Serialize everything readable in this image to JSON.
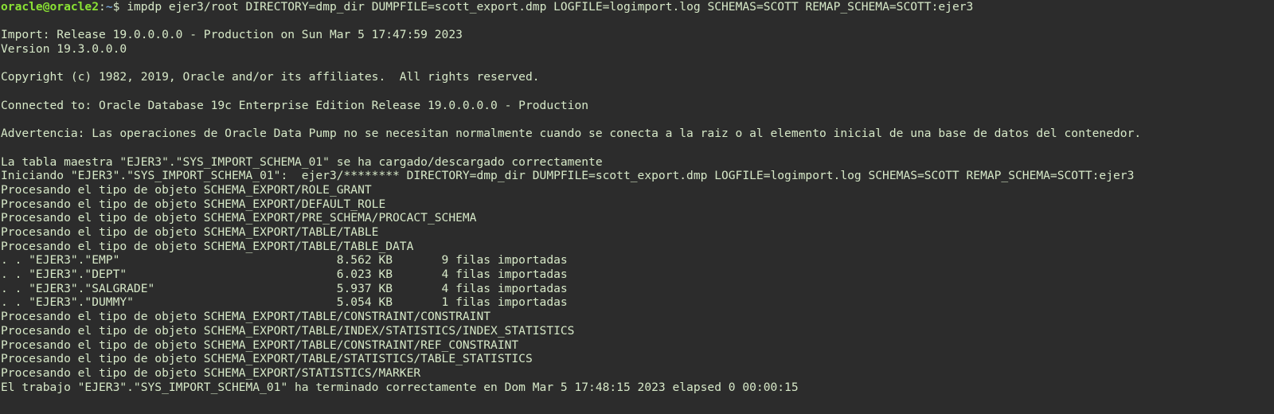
{
  "prompt": {
    "user_host": "oracle@oracle2",
    "separator": ":",
    "path": "~",
    "symbol": "$ ",
    "command": "impdp ejer3/root DIRECTORY=dmp_dir DUMPFILE=scott_export.dmp LOGFILE=logimport.log SCHEMAS=SCOTT REMAP_SCHEMA=SCOTT:ejer3"
  },
  "output": [
    "",
    "Import: Release 19.0.0.0.0 - Production on Sun Mar 5 17:47:59 2023",
    "Version 19.3.0.0.0",
    "",
    "Copyright (c) 1982, 2019, Oracle and/or its affiliates.  All rights reserved.",
    "",
    "Connected to: Oracle Database 19c Enterprise Edition Release 19.0.0.0.0 - Production",
    "",
    "Advertencia: Las operaciones de Oracle Data Pump no se necesitan normalmente cuando se conecta a la raiz o al elemento inicial de una base de datos del contenedor.",
    "",
    "La tabla maestra \"EJER3\".\"SYS_IMPORT_SCHEMA_01\" se ha cargado/descargado correctamente",
    "Iniciando \"EJER3\".\"SYS_IMPORT_SCHEMA_01\":  ejer3/******** DIRECTORY=dmp_dir DUMPFILE=scott_export.dmp LOGFILE=logimport.log SCHEMAS=SCOTT REMAP_SCHEMA=SCOTT:ejer3",
    "Procesando el tipo de objeto SCHEMA_EXPORT/ROLE_GRANT",
    "Procesando el tipo de objeto SCHEMA_EXPORT/DEFAULT_ROLE",
    "Procesando el tipo de objeto SCHEMA_EXPORT/PRE_SCHEMA/PROCACT_SCHEMA",
    "Procesando el tipo de objeto SCHEMA_EXPORT/TABLE/TABLE",
    "Procesando el tipo de objeto SCHEMA_EXPORT/TABLE/TABLE_DATA",
    ". . \"EJER3\".\"EMP\"                               8.562 KB       9 filas importadas",
    ". . \"EJER3\".\"DEPT\"                              6.023 KB       4 filas importadas",
    ". . \"EJER3\".\"SALGRADE\"                          5.937 KB       4 filas importadas",
    ". . \"EJER3\".\"DUMMY\"                             5.054 KB       1 filas importadas",
    "Procesando el tipo de objeto SCHEMA_EXPORT/TABLE/CONSTRAINT/CONSTRAINT",
    "Procesando el tipo de objeto SCHEMA_EXPORT/TABLE/INDEX/STATISTICS/INDEX_STATISTICS",
    "Procesando el tipo de objeto SCHEMA_EXPORT/TABLE/CONSTRAINT/REF_CONSTRAINT",
    "Procesando el tipo de objeto SCHEMA_EXPORT/TABLE/STATISTICS/TABLE_STATISTICS",
    "Procesando el tipo de objeto SCHEMA_EXPORT/STATISTICS/MARKER",
    "El trabajo \"EJER3\".\"SYS_IMPORT_SCHEMA_01\" ha terminado correctamente en Dom Mar 5 17:48:15 2023 elapsed 0 00:00:15"
  ],
  "colors": {
    "background": "#2c2c2c",
    "text": "#d7e9c8",
    "prompt_user": "#8ae234",
    "prompt_path": "#729fcf"
  }
}
